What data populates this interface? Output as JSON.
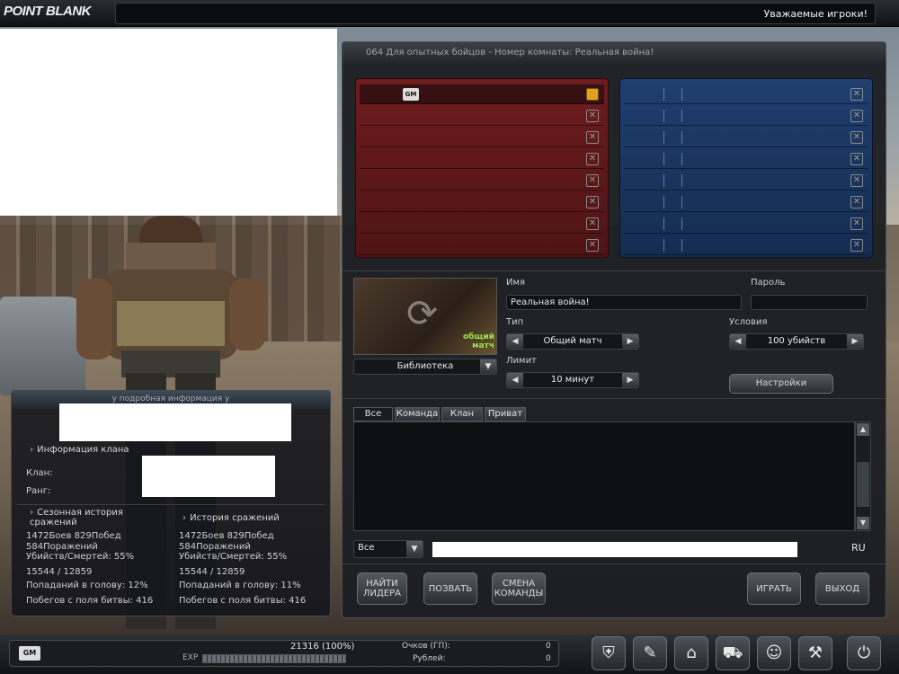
{
  "app": {
    "logo": "POINT BLANK",
    "ticker": "Уважаемые игроки!"
  },
  "room": {
    "title": "064 Для опытных бойцов - Номер комнаты: Реальная война!",
    "red_team": {
      "leader_badge": "GM",
      "slot_count": 8
    },
    "blue_team": {
      "slot_count": 8
    },
    "map": {
      "name": "Библиотека",
      "mode_badge": "общий матч"
    },
    "fields": {
      "name_label": "Имя",
      "name_value": "Реальная война!",
      "password_label": "Пароль",
      "password_value": "",
      "type_label": "Тип",
      "type_value": "Общий матч",
      "conditions_label": "Условия",
      "conditions_value": "100 убийств",
      "limit_label": "Лимит",
      "limit_value": "10 минут"
    },
    "settings_button": "Настройки",
    "chat": {
      "tabs": [
        "Все",
        "Команда",
        "Клан",
        "Приват"
      ],
      "channel": "Все",
      "input_value": "",
      "language": "RU"
    },
    "buttons": {
      "find_leader": "НАЙТИ ЛИДЕРА",
      "invite": "ПОЗВАТЬ",
      "change_team": "СМЕНА КОМАНДЫ",
      "play": "ИГРАТЬ",
      "exit": "ВЫХОД"
    }
  },
  "info": {
    "header": "у подробная информация у",
    "clan_info_title": "Информация клана",
    "clan_label": "Клан:",
    "rank_label": "Ранг:",
    "season": {
      "title": "Сезонная история сражений",
      "battles": "1472Боев 829Побед",
      "losses": "584Поражений",
      "kd": "Убийств/Смертей: 55%",
      "kills": "15544 / 12859",
      "headshots": "Попаданий в голову: 12%",
      "desertions": "Побегов с поля битвы: 416"
    },
    "history": {
      "title": "История сражений",
      "battles": "1472Боев 829Побед",
      "losses": "584Поражений",
      "kd": "Убийств/Смертей: 55%",
      "kills": "15544 / 12859",
      "headshots": "Попаданий в голову: 11%",
      "desertions": "Побегов с поля битвы: 416"
    }
  },
  "status_bar": {
    "rank_badge": "GM",
    "exp_value": "21316 (100%)",
    "exp_label": "EXP",
    "exp_fraction": 1.0,
    "points_label": "Очков (ГП):",
    "points_value": "0",
    "rubles_label": "Рублей:",
    "rubles_value": "0"
  },
  "menu_icons": [
    "clan-icon",
    "inventory-icon",
    "shop-icon",
    "cart-icon",
    "community-icon",
    "options-icon",
    "power-icon"
  ]
}
